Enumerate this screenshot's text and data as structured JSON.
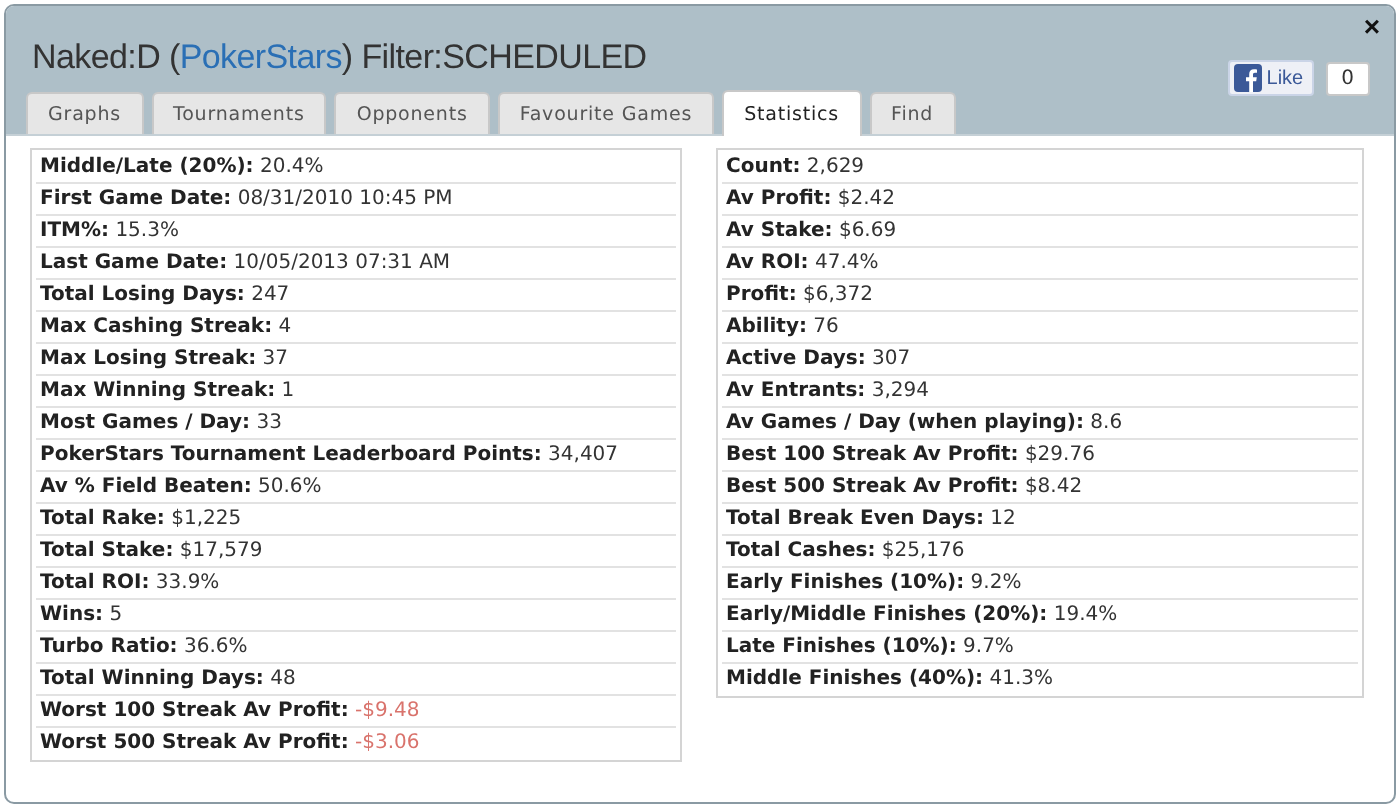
{
  "window": {
    "title_player": "Naked:D (",
    "title_site": "PokerStars",
    "title_filter": ") Filter:SCHEDULED",
    "close": "×"
  },
  "tabs": [
    {
      "label": "Graphs",
      "selected": false
    },
    {
      "label": "Tournaments",
      "selected": false
    },
    {
      "label": "Opponents",
      "selected": false
    },
    {
      "label": "Favourite Games",
      "selected": false
    },
    {
      "label": "Statistics",
      "selected": true
    },
    {
      "label": "Find",
      "selected": false
    }
  ],
  "like": {
    "label": "Like",
    "count": "0"
  },
  "left_stats": [
    {
      "label": "Middle/Late (20%):",
      "value": "20.4%",
      "negative": false
    },
    {
      "label": "First Game Date:",
      "value": "08/31/2010 10:45 PM",
      "negative": false
    },
    {
      "label": "ITM%:",
      "value": "15.3%",
      "negative": false
    },
    {
      "label": "Last Game Date:",
      "value": "10/05/2013 07:31 AM",
      "negative": false
    },
    {
      "label": "Total Losing Days:",
      "value": "247",
      "negative": false
    },
    {
      "label": "Max Cashing Streak:",
      "value": "4",
      "negative": false
    },
    {
      "label": "Max Losing Streak:",
      "value": "37",
      "negative": false
    },
    {
      "label": "Max Winning Streak:",
      "value": "1",
      "negative": false
    },
    {
      "label": "Most Games / Day:",
      "value": "33",
      "negative": false
    },
    {
      "label": "PokerStars Tournament Leaderboard Points:",
      "value": "34,407",
      "negative": false
    },
    {
      "label": "Av % Field Beaten:",
      "value": "50.6%",
      "negative": false
    },
    {
      "label": "Total Rake:",
      "value": "$1,225",
      "negative": false
    },
    {
      "label": "Total Stake:",
      "value": "$17,579",
      "negative": false
    },
    {
      "label": "Total ROI:",
      "value": "33.9%",
      "negative": false
    },
    {
      "label": "Wins:",
      "value": "5",
      "negative": false
    },
    {
      "label": "Turbo Ratio:",
      "value": "36.6%",
      "negative": false
    },
    {
      "label": "Total Winning Days:",
      "value": "48",
      "negative": false
    },
    {
      "label": "Worst 100 Streak Av Profit:",
      "value": "-$9.48",
      "negative": true
    },
    {
      "label": "Worst 500 Streak Av Profit:",
      "value": "-$3.06",
      "negative": true
    }
  ],
  "right_stats": [
    {
      "label": "Count:",
      "value": "2,629",
      "negative": false
    },
    {
      "label": "Av Profit:",
      "value": "$2.42",
      "negative": false
    },
    {
      "label": "Av Stake:",
      "value": "$6.69",
      "negative": false
    },
    {
      "label": "Av ROI:",
      "value": "47.4%",
      "negative": false
    },
    {
      "label": "Profit:",
      "value": "$6,372",
      "negative": false
    },
    {
      "label": "Ability:",
      "value": "76",
      "negative": false
    },
    {
      "label": "Active Days:",
      "value": "307",
      "negative": false
    },
    {
      "label": "Av Entrants:",
      "value": "3,294",
      "negative": false
    },
    {
      "label": "Av Games / Day (when playing):",
      "value": "8.6",
      "negative": false
    },
    {
      "label": "Best 100 Streak Av Profit:",
      "value": "$29.76",
      "negative": false
    },
    {
      "label": "Best 500 Streak Av Profit:",
      "value": "$8.42",
      "negative": false
    },
    {
      "label": "Total Break Even Days:",
      "value": "12",
      "negative": false
    },
    {
      "label": "Total Cashes:",
      "value": "$25,176",
      "negative": false
    },
    {
      "label": "Early Finishes (10%):",
      "value": "9.2%",
      "negative": false
    },
    {
      "label": "Early/Middle Finishes (20%):",
      "value": "19.4%",
      "negative": false
    },
    {
      "label": "Late Finishes (10%):",
      "value": "9.7%",
      "negative": false
    },
    {
      "label": "Middle Finishes (40%):",
      "value": "41.3%",
      "negative": false
    }
  ]
}
